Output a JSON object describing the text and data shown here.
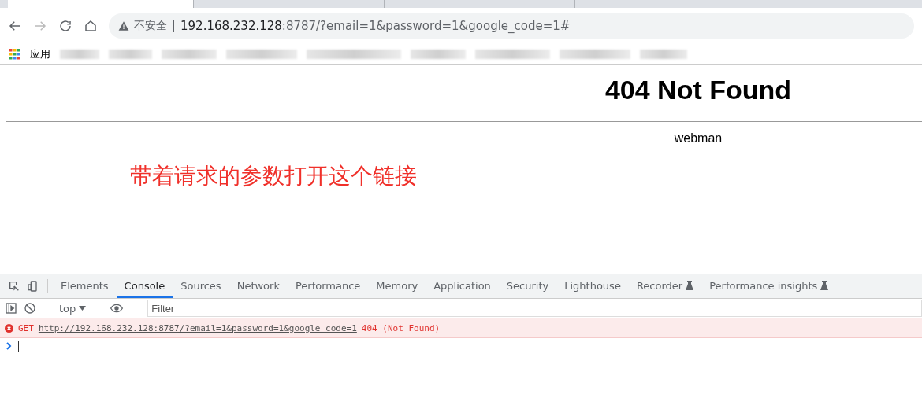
{
  "browser": {
    "tabs": [
      {
        "selected": true
      },
      {
        "selected": false
      },
      {
        "selected": false
      }
    ],
    "security_label": "不安全",
    "url_host": "192.168.232.128",
    "url_rest": ":8787/?email=1&password=1&google_code=1#",
    "bookmarks": {
      "apps_label": "应用"
    }
  },
  "page": {
    "heading": "404 Not Found",
    "footer": "webman",
    "annotation": "带着请求的参数打开这个链接"
  },
  "devtools": {
    "tabs": [
      {
        "label": "Elements",
        "selected": false,
        "experimental": false
      },
      {
        "label": "Console",
        "selected": true,
        "experimental": false
      },
      {
        "label": "Sources",
        "selected": false,
        "experimental": false
      },
      {
        "label": "Network",
        "selected": false,
        "experimental": false
      },
      {
        "label": "Performance",
        "selected": false,
        "experimental": false
      },
      {
        "label": "Memory",
        "selected": false,
        "experimental": false
      },
      {
        "label": "Application",
        "selected": false,
        "experimental": false
      },
      {
        "label": "Security",
        "selected": false,
        "experimental": false
      },
      {
        "label": "Lighthouse",
        "selected": false,
        "experimental": false
      },
      {
        "label": "Recorder",
        "selected": false,
        "experimental": true
      },
      {
        "label": "Performance insights",
        "selected": false,
        "experimental": true
      }
    ],
    "context": "top",
    "filter_placeholder": "Filter",
    "messages": [
      {
        "method": "GET",
        "url": "http://192.168.232.128:8787/?email=1&password=1&google_code=1",
        "status": "404 (Not Found)"
      }
    ]
  }
}
